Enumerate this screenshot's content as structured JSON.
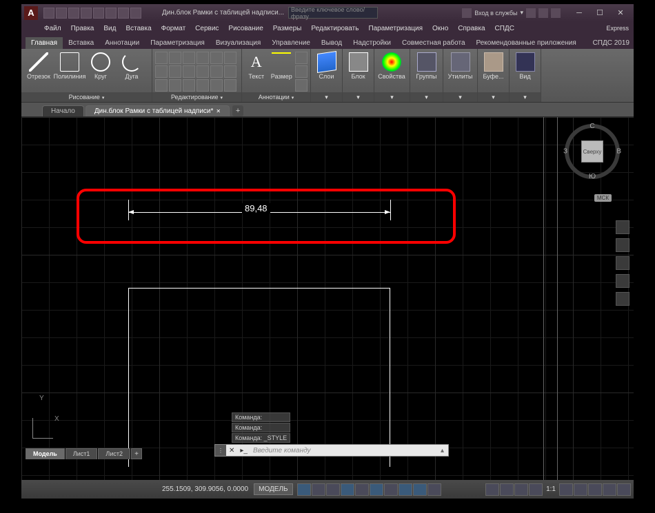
{
  "title": "Дин.блок Рамки с таблицей надписи...",
  "search_placeholder": "Введите ключевое слово/фразу",
  "sign_in": "Вход в службы",
  "menu": [
    "Файл",
    "Правка",
    "Вид",
    "Вставка",
    "Формат",
    "Сервис",
    "Рисование",
    "Размеры",
    "Редактировать",
    "Параметризация",
    "Окно",
    "Справка",
    "СПДС"
  ],
  "exp": "Express",
  "ribbon_tabs": [
    "Главная",
    "Вставка",
    "Аннотации",
    "Параметризация",
    "Визуализация",
    "Управление",
    "Вывод",
    "Надстройки",
    "Совместная работа",
    "Рекомендованные приложения",
    "СПДС 2019"
  ],
  "panels": {
    "draw": {
      "title": "Рисование",
      "items": [
        "Отрезок",
        "Полилиния",
        "Круг",
        "Дуга"
      ]
    },
    "modify": {
      "title": "Редактирование"
    },
    "annot": {
      "title": "Аннотации",
      "text": "Текст",
      "dim": "Размер"
    },
    "layers": {
      "title": "Слои"
    },
    "block": {
      "title": "Блок"
    },
    "props": {
      "title": "Свойства"
    },
    "groups": {
      "title": "Группы"
    },
    "util": {
      "title": "Утилиты"
    },
    "clip": {
      "title": "Буфе..."
    },
    "view": {
      "title": "Вид"
    }
  },
  "file_tabs": {
    "start": "Начало",
    "active": "Дин.блок Рамки с таблицей надписи*"
  },
  "dimension_value": "89,48",
  "viewcube": {
    "n": "С",
    "s": "Ю",
    "e": "В",
    "w": "З",
    "face": "Сверху",
    "wcs": "МСК"
  },
  "ucs": {
    "x": "X",
    "y": "Y"
  },
  "cmd_history": [
    "Команда:",
    "Команда:",
    "Команда: _STYLE"
  ],
  "cmd_placeholder": "Введите команду",
  "layout_tabs": [
    "Модель",
    "Лист1",
    "Лист2"
  ],
  "status": {
    "coords": "255.1509, 309.9056, 0.0000",
    "model": "МОДЕЛЬ",
    "scale": "1:1"
  }
}
